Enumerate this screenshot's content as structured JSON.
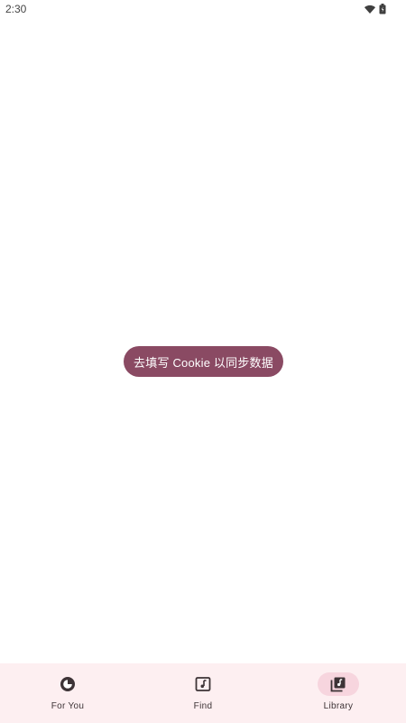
{
  "status_bar": {
    "time": "2:30",
    "icons": [
      "wifi-icon",
      "battery-icon"
    ]
  },
  "main": {
    "cookie_button_label": "去填写 Cookie 以同步数据"
  },
  "bottom_nav": {
    "items": [
      {
        "label": "For You",
        "icon": "for-you-icon",
        "active": false
      },
      {
        "label": "Find",
        "icon": "music-note-square-icon",
        "active": false
      },
      {
        "label": "Library",
        "icon": "library-music-icon",
        "active": true
      }
    ]
  },
  "colors": {
    "accent": "#8a4a63",
    "nav_background": "#fdeff1",
    "active_indicator": "#f7d5de"
  }
}
